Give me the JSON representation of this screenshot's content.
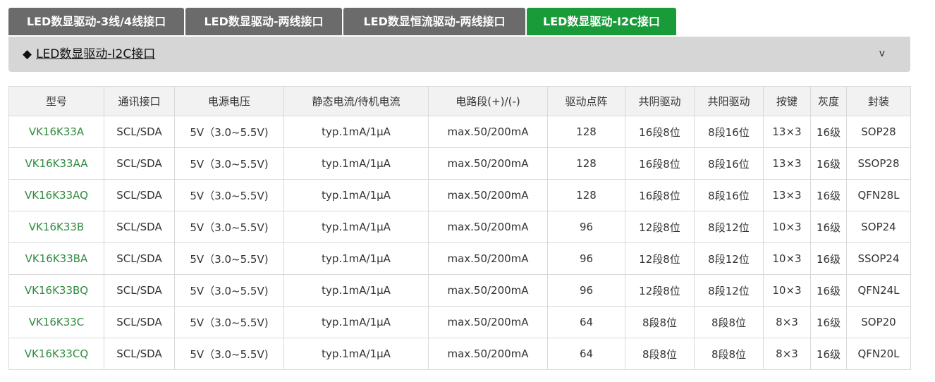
{
  "tabs": [
    {
      "label": "LED数显驱动-3线/4线接口",
      "active": false
    },
    {
      "label": "LED数显驱动-两线接口",
      "active": false
    },
    {
      "label": "LED数显恒流驱动-两线接口",
      "active": false
    },
    {
      "label": "LED数显驱动-I2C接口",
      "active": true
    }
  ],
  "accordion": {
    "marker": "◆",
    "title": "LED数显驱动-I2C接口",
    "chevron": "v"
  },
  "table": {
    "headers": [
      "型号",
      "通讯接口",
      "电源电压",
      "静态电流/待机电流",
      "电路段(+)/(-)",
      "驱动点阵",
      "共阴驱动",
      "共阳驱动",
      "按键",
      "灰度",
      "封装"
    ],
    "rows": [
      [
        "VK16K33A",
        "SCL/SDA",
        "5V（3.0~5.5V)",
        "typ.1mA/1μA",
        "max.50/200mA",
        "128",
        "16段8位",
        "8段16位",
        "13×3",
        "16级",
        "SOP28"
      ],
      [
        "VK16K33AA",
        "SCL/SDA",
        "5V（3.0~5.5V)",
        "typ.1mA/1μA",
        "max.50/200mA",
        "128",
        "16段8位",
        "8段16位",
        "13×3",
        "16级",
        "SSOP28"
      ],
      [
        "VK16K33AQ",
        "SCL/SDA",
        "5V（3.0~5.5V)",
        "typ.1mA/1μA",
        "max.50/200mA",
        "128",
        "16段8位",
        "8段16位",
        "13×3",
        "16级",
        "QFN28L"
      ],
      [
        "VK16K33B",
        "SCL/SDA",
        "5V（3.0~5.5V)",
        "typ.1mA/1μA",
        "max.50/200mA",
        "96",
        "12段8位",
        "8段12位",
        "10×3",
        "16级",
        "SOP24"
      ],
      [
        "VK16K33BA",
        "SCL/SDA",
        "5V（3.0~5.5V)",
        "typ.1mA/1μA",
        "max.50/200mA",
        "96",
        "12段8位",
        "8段12位",
        "10×3",
        "16级",
        "SSOP24"
      ],
      [
        "VK16K33BQ",
        "SCL/SDA",
        "5V（3.0~5.5V)",
        "typ.1mA/1μA",
        "max.50/200mA",
        "96",
        "12段8位",
        "8段12位",
        "10×3",
        "16级",
        "QFN24L"
      ],
      [
        "VK16K33C",
        "SCL/SDA",
        "5V（3.0~5.5V)",
        "typ.1mA/1μA",
        "max.50/200mA",
        "64",
        "8段8位",
        "8段8位",
        "8×3",
        "16级",
        "SOP20"
      ],
      [
        "VK16K33CQ",
        "SCL/SDA",
        "5V（3.0~5.5V)",
        "typ.1mA/1μA",
        "max.50/200mA",
        "64",
        "8段8位",
        "8段8位",
        "8×3",
        "16级",
        "QFN20L"
      ]
    ]
  },
  "colors": {
    "active_tab": "#1a9b3a",
    "inactive_tab": "#6b6b6b",
    "model_link": "#2e8b3d"
  }
}
